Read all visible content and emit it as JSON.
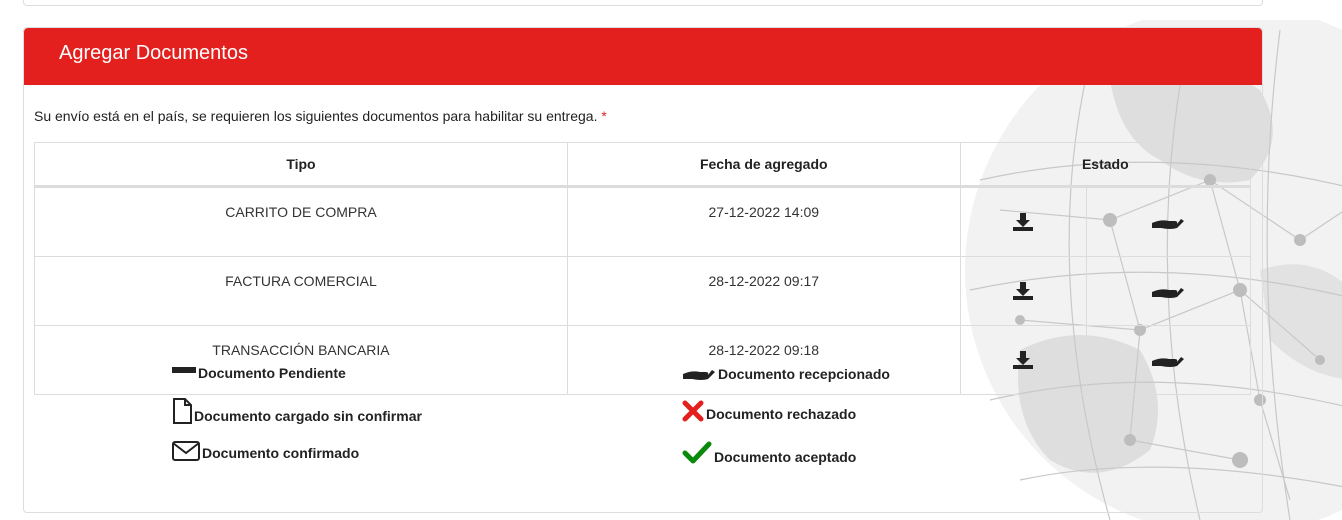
{
  "card": {
    "title": "Agregar Documentos",
    "intro": "Su envío está en el país, se requieren los siguientes documentos para habilitar su entrega.",
    "required_mark": "*"
  },
  "table": {
    "headers": [
      "Tipo",
      "Fecha de agregado",
      "Estado"
    ],
    "rows": [
      {
        "tipo": "CARRITO DE COMPRA",
        "fecha": "27-12-2022 14:09",
        "action_icon": "download-icon",
        "status_icon": "hand-receive-icon"
      },
      {
        "tipo": "FACTURA COMERCIAL",
        "fecha": "28-12-2022 09:17",
        "action_icon": "download-icon",
        "status_icon": "hand-receive-icon"
      },
      {
        "tipo": "TRANSACCIÓN BANCARIA",
        "fecha": "28-12-2022 09:18",
        "action_icon": "download-icon",
        "status_icon": "hand-receive-icon"
      }
    ]
  },
  "legend": {
    "pending": "Documento Pendiente",
    "uploaded": "Documento cargado sin confirmar",
    "confirmed": "Documento confirmado",
    "received": "Documento recepcionado",
    "rejected": "Documento rechazado",
    "accepted": "Documento aceptado"
  },
  "colors": {
    "header_bg": "#e3201e",
    "required": "#e3201e",
    "rejected": "#e3201e",
    "accepted": "#0a8a0a"
  }
}
